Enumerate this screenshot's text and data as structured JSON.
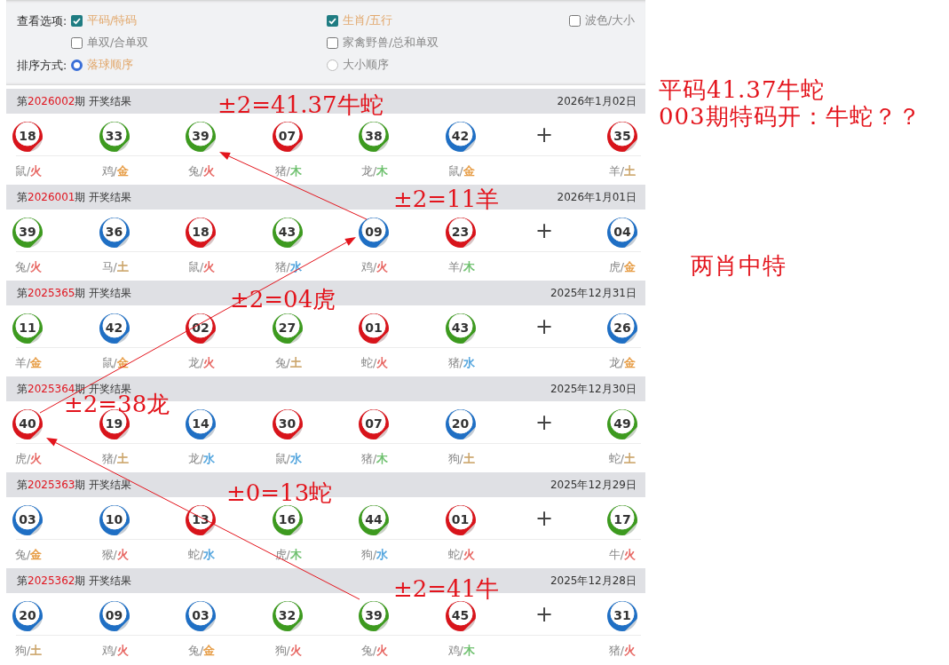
{
  "filter_options": {
    "view_label": "查看选项:",
    "view_options": [
      {
        "label": "平码/特码",
        "checked": true
      },
      {
        "label": "生肖/五行",
        "checked": true
      },
      {
        "label": "波色/大小",
        "checked": false
      },
      {
        "label": "单双/合单双",
        "checked": false
      },
      {
        "label": "家禽野兽/总和单双",
        "checked": false
      }
    ],
    "sort_label": "排序方式:",
    "sort_options": [
      {
        "label": "落球顺序",
        "selected": true
      },
      {
        "label": "大小顺序",
        "selected": false
      }
    ]
  },
  "draws": [
    {
      "title_prefix": "第",
      "period": "2026002",
      "title_suffix": "期 开奖结果",
      "date": "2026年1月02日",
      "balls": [
        {
          "number": "18",
          "color": "#d8141b",
          "zodiac": "鼠",
          "separator": "/",
          "element": {
            "label": "火",
            "color": "#e6605c"
          }
        },
        {
          "number": "33",
          "color": "#3d9a1f",
          "zodiac": "鸡",
          "separator": "/",
          "element": {
            "label": "金",
            "color": "#e69a40"
          }
        },
        {
          "number": "39",
          "color": "#3d9a1f",
          "zodiac": "兔",
          "separator": "/",
          "element": {
            "label": "火",
            "color": "#e6605c"
          }
        },
        {
          "number": "07",
          "color": "#d8141b",
          "zodiac": "猪",
          "separator": "/",
          "element": {
            "label": "木",
            "color": "#6cbf6c"
          }
        },
        {
          "number": "38",
          "color": "#3d9a1f",
          "zodiac": "龙",
          "separator": "/",
          "element": {
            "label": "木",
            "color": "#6cbf6c"
          }
        },
        {
          "number": "42",
          "color": "#1f6fc4",
          "zodiac": "鼠",
          "separator": "/",
          "element": {
            "label": "金",
            "color": "#e69a40"
          }
        }
      ],
      "plus": "+",
      "special_ball": {
        "number": "35",
        "color": "#d8141b",
        "zodiac": "羊",
        "separator": "/",
        "element": {
          "label": "土",
          "color": "#c9a062"
        }
      }
    },
    {
      "title_prefix": "第",
      "period": "2026001",
      "title_suffix": "期 开奖结果",
      "date": "2026年1月01日",
      "balls": [
        {
          "number": "39",
          "color": "#3d9a1f",
          "zodiac": "兔",
          "separator": "/",
          "element": {
            "label": "火",
            "color": "#e6605c"
          }
        },
        {
          "number": "36",
          "color": "#1f6fc4",
          "zodiac": "马",
          "separator": "/",
          "element": {
            "label": "土",
            "color": "#c9a062"
          }
        },
        {
          "number": "18",
          "color": "#d8141b",
          "zodiac": "鼠",
          "separator": "/",
          "element": {
            "label": "火",
            "color": "#e6605c"
          }
        },
        {
          "number": "43",
          "color": "#3d9a1f",
          "zodiac": "猪",
          "separator": "/",
          "element": {
            "label": "水",
            "color": "#4aa0dc"
          }
        },
        {
          "number": "09",
          "color": "#1f6fc4",
          "zodiac": "鸡",
          "separator": "/",
          "element": {
            "label": "火",
            "color": "#e6605c"
          }
        },
        {
          "number": "23",
          "color": "#d8141b",
          "zodiac": "羊",
          "separator": "/",
          "element": {
            "label": "木",
            "color": "#6cbf6c"
          }
        }
      ],
      "plus": "+",
      "special_ball": {
        "number": "04",
        "color": "#1f6fc4",
        "zodiac": "虎",
        "separator": "/",
        "element": {
          "label": "金",
          "color": "#e69a40"
        }
      }
    },
    {
      "title_prefix": "第",
      "period": "2025365",
      "title_suffix": "期 开奖结果",
      "date": "2025年12月31日",
      "balls": [
        {
          "number": "11",
          "color": "#3d9a1f",
          "zodiac": "羊",
          "separator": "/",
          "element": {
            "label": "金",
            "color": "#e69a40"
          }
        },
        {
          "number": "42",
          "color": "#1f6fc4",
          "zodiac": "鼠",
          "separator": "/",
          "element": {
            "label": "金",
            "color": "#e69a40"
          }
        },
        {
          "number": "02",
          "color": "#d8141b",
          "zodiac": "龙",
          "separator": "/",
          "element": {
            "label": "火",
            "color": "#e6605c"
          }
        },
        {
          "number": "27",
          "color": "#3d9a1f",
          "zodiac": "兔",
          "separator": "/",
          "element": {
            "label": "土",
            "color": "#c9a062"
          }
        },
        {
          "number": "01",
          "color": "#d8141b",
          "zodiac": "蛇",
          "separator": "/",
          "element": {
            "label": "火",
            "color": "#e6605c"
          }
        },
        {
          "number": "43",
          "color": "#3d9a1f",
          "zodiac": "猪",
          "separator": "/",
          "element": {
            "label": "水",
            "color": "#4aa0dc"
          }
        }
      ],
      "plus": "+",
      "special_ball": {
        "number": "26",
        "color": "#1f6fc4",
        "zodiac": "龙",
        "separator": "/",
        "element": {
          "label": "金",
          "color": "#e69a40"
        }
      }
    },
    {
      "title_prefix": "第",
      "period": "2025364",
      "title_suffix": "期 开奖结果",
      "date": "2025年12月30日",
      "balls": [
        {
          "number": "40",
          "color": "#d8141b",
          "zodiac": "虎",
          "separator": "/",
          "element": {
            "label": "火",
            "color": "#e6605c"
          }
        },
        {
          "number": "19",
          "color": "#d8141b",
          "zodiac": "猪",
          "separator": "/",
          "element": {
            "label": "土",
            "color": "#c9a062"
          }
        },
        {
          "number": "14",
          "color": "#1f6fc4",
          "zodiac": "龙",
          "separator": "/",
          "element": {
            "label": "水",
            "color": "#4aa0dc"
          }
        },
        {
          "number": "30",
          "color": "#d8141b",
          "zodiac": "鼠",
          "separator": "/",
          "element": {
            "label": "水",
            "color": "#4aa0dc"
          }
        },
        {
          "number": "07",
          "color": "#d8141b",
          "zodiac": "猪",
          "separator": "/",
          "element": {
            "label": "木",
            "color": "#6cbf6c"
          }
        },
        {
          "number": "20",
          "color": "#1f6fc4",
          "zodiac": "狗",
          "separator": "/",
          "element": {
            "label": "土",
            "color": "#c9a062"
          }
        }
      ],
      "plus": "+",
      "special_ball": {
        "number": "49",
        "color": "#3d9a1f",
        "zodiac": "蛇",
        "separator": "/",
        "element": {
          "label": "土",
          "color": "#c9a062"
        }
      }
    },
    {
      "title_prefix": "第",
      "period": "2025363",
      "title_suffix": "期 开奖结果",
      "date": "2025年12月29日",
      "balls": [
        {
          "number": "03",
          "color": "#1f6fc4",
          "zodiac": "兔",
          "separator": "/",
          "element": {
            "label": "金",
            "color": "#e69a40"
          }
        },
        {
          "number": "10",
          "color": "#1f6fc4",
          "zodiac": "猴",
          "separator": "/",
          "element": {
            "label": "火",
            "color": "#e6605c"
          }
        },
        {
          "number": "13",
          "color": "#d8141b",
          "zodiac": "蛇",
          "separator": "/",
          "element": {
            "label": "水",
            "color": "#4aa0dc"
          }
        },
        {
          "number": "16",
          "color": "#3d9a1f",
          "zodiac": "虎",
          "separator": "/",
          "element": {
            "label": "木",
            "color": "#6cbf6c"
          }
        },
        {
          "number": "44",
          "color": "#3d9a1f",
          "zodiac": "狗",
          "separator": "/",
          "element": {
            "label": "水",
            "color": "#4aa0dc"
          }
        },
        {
          "number": "01",
          "color": "#d8141b",
          "zodiac": "蛇",
          "separator": "/",
          "element": {
            "label": "火",
            "color": "#e6605c"
          }
        }
      ],
      "plus": "+",
      "special_ball": {
        "number": "17",
        "color": "#3d9a1f",
        "zodiac": "牛",
        "separator": "/",
        "element": {
          "label": "火",
          "color": "#e6605c"
        }
      }
    },
    {
      "title_prefix": "第",
      "period": "2025362",
      "title_suffix": "期 开奖结果",
      "date": "2025年12月28日",
      "balls": [
        {
          "number": "20",
          "color": "#1f6fc4",
          "zodiac": "狗",
          "separator": "/",
          "element": {
            "label": "土",
            "color": "#c9a062"
          }
        },
        {
          "number": "09",
          "color": "#1f6fc4",
          "zodiac": "鸡",
          "separator": "/",
          "element": {
            "label": "火",
            "color": "#e6605c"
          }
        },
        {
          "number": "03",
          "color": "#1f6fc4",
          "zodiac": "兔",
          "separator": "/",
          "element": {
            "label": "金",
            "color": "#e69a40"
          }
        },
        {
          "number": "32",
          "color": "#3d9a1f",
          "zodiac": "狗",
          "separator": "/",
          "element": {
            "label": "火",
            "color": "#e6605c"
          }
        },
        {
          "number": "39",
          "color": "#3d9a1f",
          "zodiac": "兔",
          "separator": "/",
          "element": {
            "label": "火",
            "color": "#e6605c"
          }
        },
        {
          "number": "45",
          "color": "#d8141b",
          "zodiac": "鸡",
          "separator": "/",
          "element": {
            "label": "木",
            "color": "#6cbf6c"
          }
        }
      ],
      "plus": "+",
      "special_ball": {
        "number": "31",
        "color": "#1f6fc4",
        "zodiac": "猪",
        "separator": "/",
        "element": {
          "label": "火",
          "color": "#e6605c"
        }
      }
    }
  ],
  "annotations": [
    "±2=41.37牛蛇",
    "±2=11羊",
    "±2=04虎",
    "±2=38龙",
    "±0=13蛇",
    "±2=41牛"
  ],
  "notes": [
    "平码41.37牛蛇",
    "003期特码开：牛蛇？？",
    "两肖中特"
  ]
}
